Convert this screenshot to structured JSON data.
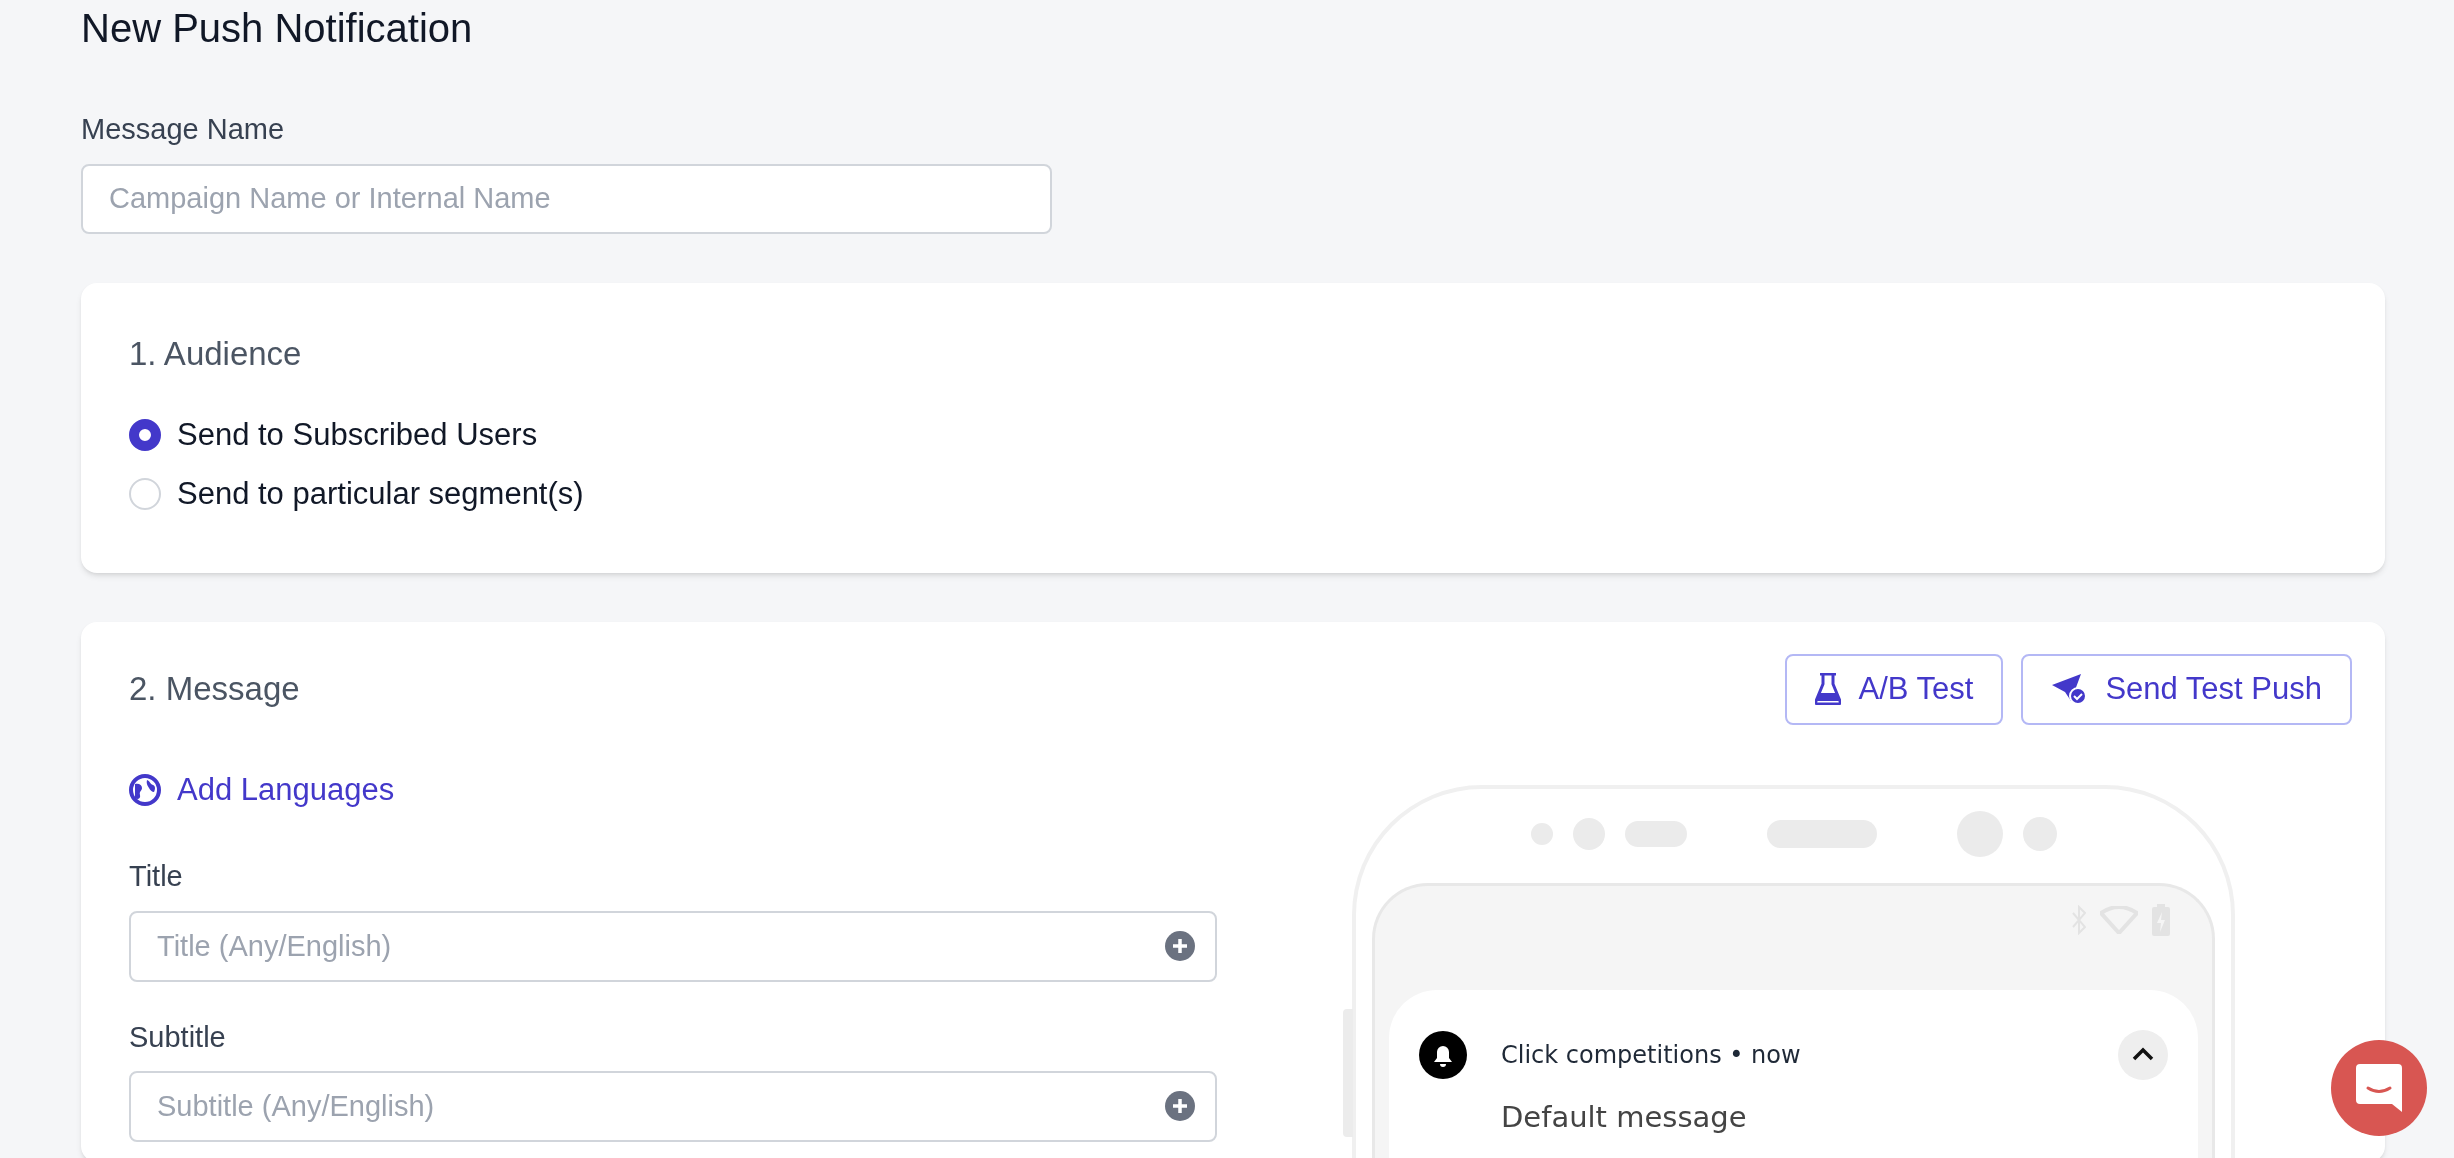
{
  "page": {
    "title": "New Push Notification"
  },
  "message_name": {
    "label": "Message Name",
    "placeholder": "Campaign Name or Internal Name"
  },
  "audience": {
    "heading": "1. Audience",
    "options": [
      {
        "label": "Send to Subscribed Users",
        "selected": true
      },
      {
        "label": "Send to particular segment(s)",
        "selected": false
      }
    ]
  },
  "message": {
    "heading": "2. Message",
    "buttons": [
      {
        "label": "A/B Test",
        "kind": "ab-test"
      },
      {
        "label": "Send Test Push",
        "kind": "test-push"
      }
    ],
    "add_languages": "Add Languages",
    "fields": [
      {
        "label": "Title",
        "placeholder": "Title (Any/English)"
      },
      {
        "label": "Subtitle",
        "placeholder": "Subtitle (Any/English)"
      }
    ],
    "preview": {
      "app_line": "Click competitions • now",
      "body": "Default message"
    }
  }
}
